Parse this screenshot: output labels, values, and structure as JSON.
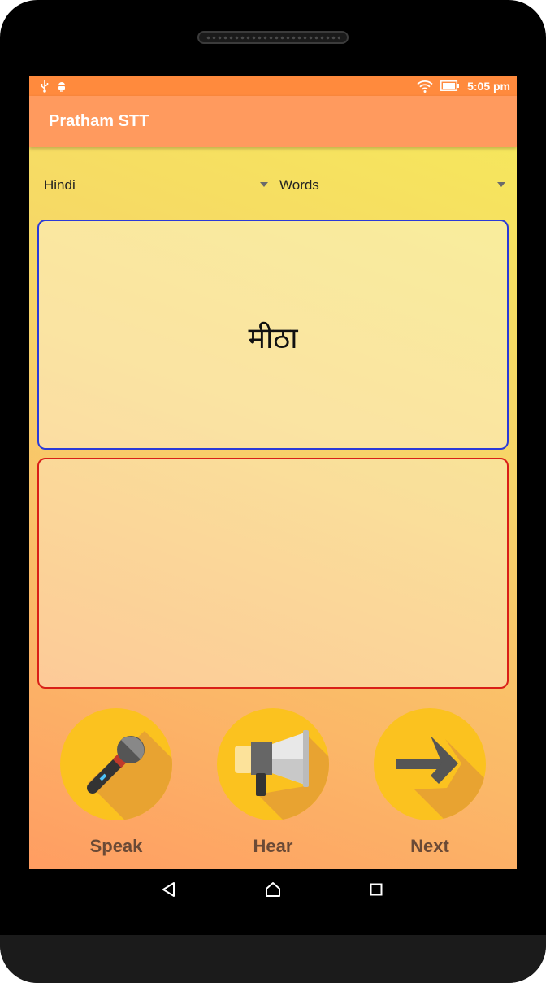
{
  "status_bar": {
    "time": "5:05 pm",
    "icons": [
      "usb-icon",
      "android-debug-icon",
      "wifi-icon",
      "battery-icon"
    ]
  },
  "app_bar": {
    "title": "Pratham STT"
  },
  "spinners": {
    "language": {
      "value": "Hindi"
    },
    "mode": {
      "value": "Words"
    }
  },
  "word_card": {
    "word": "मीठा"
  },
  "result_card": {
    "text": ""
  },
  "actions": {
    "speak": {
      "label": "Speak",
      "icon": "microphone-icon"
    },
    "hear": {
      "label": "Hear",
      "icon": "megaphone-icon"
    },
    "next": {
      "label": "Next",
      "icon": "arrow-right-icon"
    }
  },
  "nav_bar": {
    "icons": [
      "back-icon",
      "home-icon",
      "recents-icon"
    ]
  },
  "colors": {
    "status_bar": "#ff8a3d",
    "app_bar": "#ff9a5e",
    "word_border": "#2a3ad8",
    "result_border": "#d91f17",
    "action_circle": "#fbc21f",
    "action_label": "#6b4a36"
  }
}
